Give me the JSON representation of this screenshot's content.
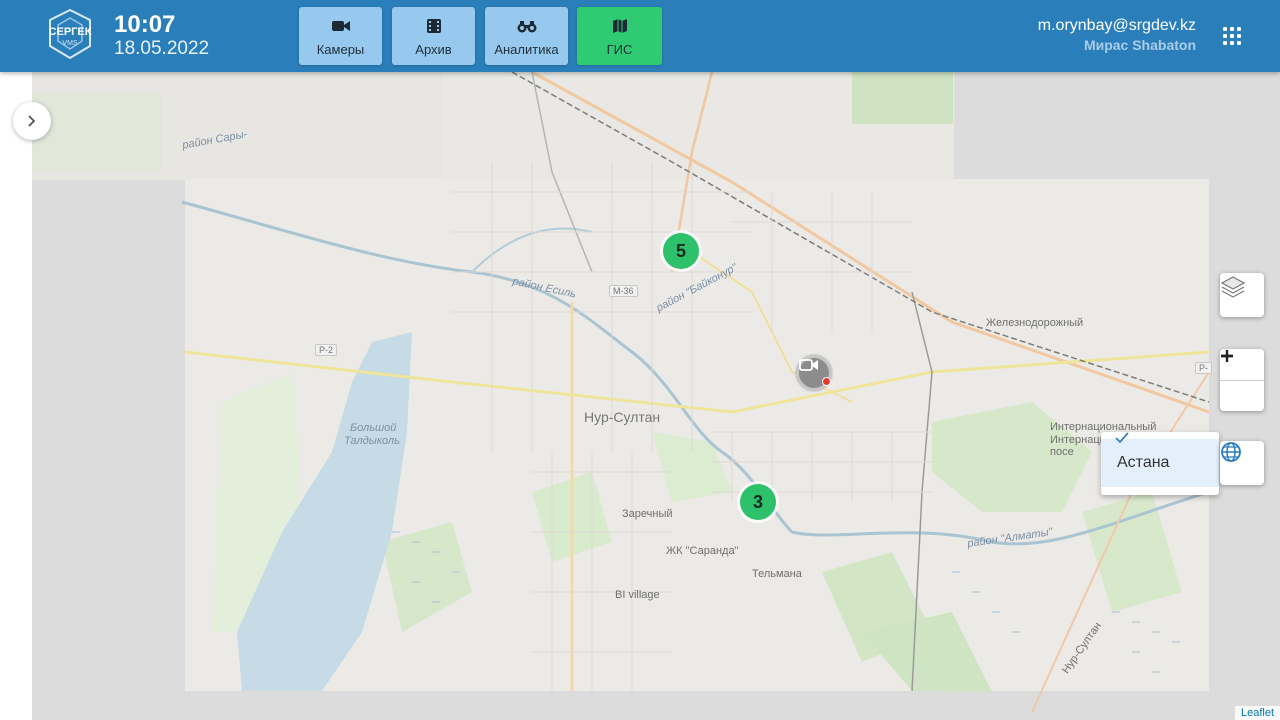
{
  "header": {
    "logo_text_main": "СЕРГЕК",
    "logo_text_sub": "VMS",
    "time": "10:07",
    "date": "18.05.2022",
    "nav": [
      {
        "label": "Камеры",
        "icon": "video-camera-icon",
        "active": false
      },
      {
        "label": "Архив",
        "icon": "film-archive-icon",
        "active": false
      },
      {
        "label": "Аналитика",
        "icon": "binoculars-icon",
        "active": false
      },
      {
        "label": "ГИС",
        "icon": "map-icon",
        "active": true
      }
    ],
    "user_email": "m.orynbay@srgdev.kz",
    "user_name": "Мирас Shabaton",
    "accent": "#2a7fba",
    "nav_color": "#97c9ef",
    "active_color": "#2fcb72"
  },
  "map": {
    "clusters": [
      {
        "count": "5"
      },
      {
        "count": "3"
      }
    ],
    "labels": {
      "city": "Нур-Султан",
      "district_rail": "Железнодорожный",
      "district_intl": "Интернациональный",
      "district_intl_2": "Интернацио",
      "district_intl_3": "посе",
      "zarechny": "Заречный",
      "saranda": "ЖК \"Саранда\"",
      "telmana": "Тельмана",
      "bi_village": "BI village",
      "lake_1": "Большой",
      "lake_2": "Талдыколь",
      "rayon_almaty": "район \"Алматы\"",
      "rayon_saryarka": "район Сары-",
      "rayon_esil": "район Есиль",
      "rayon_baikonur": "район \"Байконур\"",
      "road_m36": "М-36",
      "road_r2": "Р-2",
      "road_r": "Р-",
      "nur_sultan_road": "Нур-Султан"
    },
    "city_selector": {
      "option": "Астана",
      "selected": true
    },
    "attribution": "Leaflet",
    "cluster_color": "#2ec16c"
  }
}
